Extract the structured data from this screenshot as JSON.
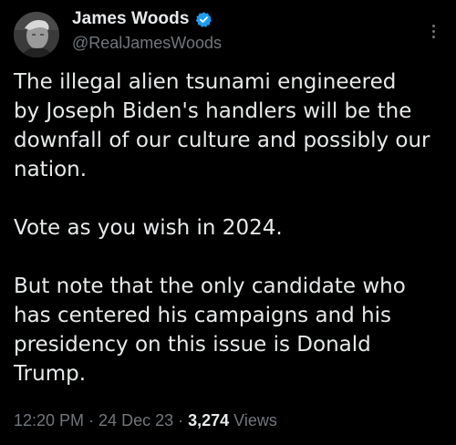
{
  "author": {
    "display_name": "James Woods",
    "handle": "@RealJamesWoods",
    "verified_icon": "verified-badge-icon",
    "verified_color": "#1d9bf0"
  },
  "tweet": {
    "paragraphs": [
      {
        "lines": [
          "The illegal alien tsunami engineered",
          "by Joseph Biden's handlers will be the",
          "downfall of our culture and possibly our",
          "nation."
        ]
      },
      {
        "lines": [
          "Vote as you wish in 2024."
        ]
      },
      {
        "lines": [
          "But note that the only candidate who",
          "has centered his campaigns and his",
          "presidency on this issue is Donald",
          "Trump."
        ]
      }
    ]
  },
  "meta": {
    "time": "12:20 PM",
    "separator": " · ",
    "date": "24 Dec 23",
    "views_count": "3,274",
    "views_label": "Views"
  },
  "colors": {
    "background": "#000000",
    "primary_text": "#e7e9ea",
    "secondary_text": "#71767b"
  }
}
